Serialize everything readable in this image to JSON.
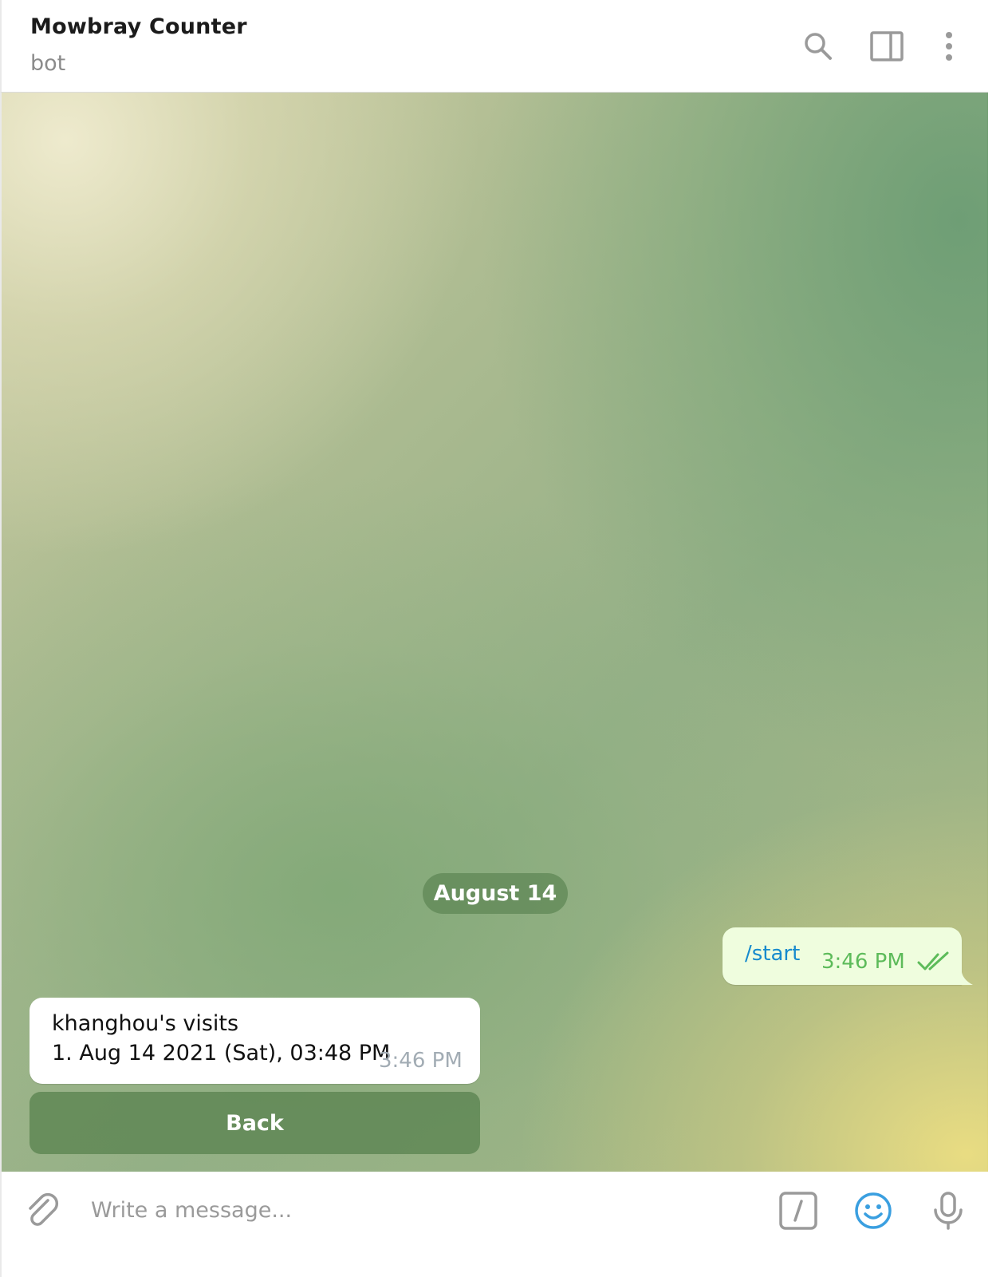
{
  "header": {
    "title": "Mowbray Counter",
    "status": "bot",
    "icons": [
      "search-icon",
      "sidebar-toggle-icon",
      "more-vertical-icon"
    ]
  },
  "chat": {
    "date_separator": "August 14",
    "outgoing": {
      "text": "/start",
      "time": "3:46 PM",
      "status_icon": "double-check-icon"
    },
    "incoming": {
      "line1": "khanghou's visits",
      "line2": "1. Aug 14 2021 (Sat), 03:48 PM",
      "time": "3:46 PM"
    },
    "keyboard_button": "Back"
  },
  "composer": {
    "placeholder": "Write a message...",
    "icons": [
      "paperclip-icon",
      "bot-command-icon",
      "emoji-icon",
      "microphone-icon"
    ]
  },
  "colors": {
    "accent": "#168acd",
    "outgoing_bubble": "#effdde",
    "read_check": "#5dbb5a",
    "emoji_icon": "#3a9fe0",
    "icon_gray": "#9a9a9a"
  }
}
